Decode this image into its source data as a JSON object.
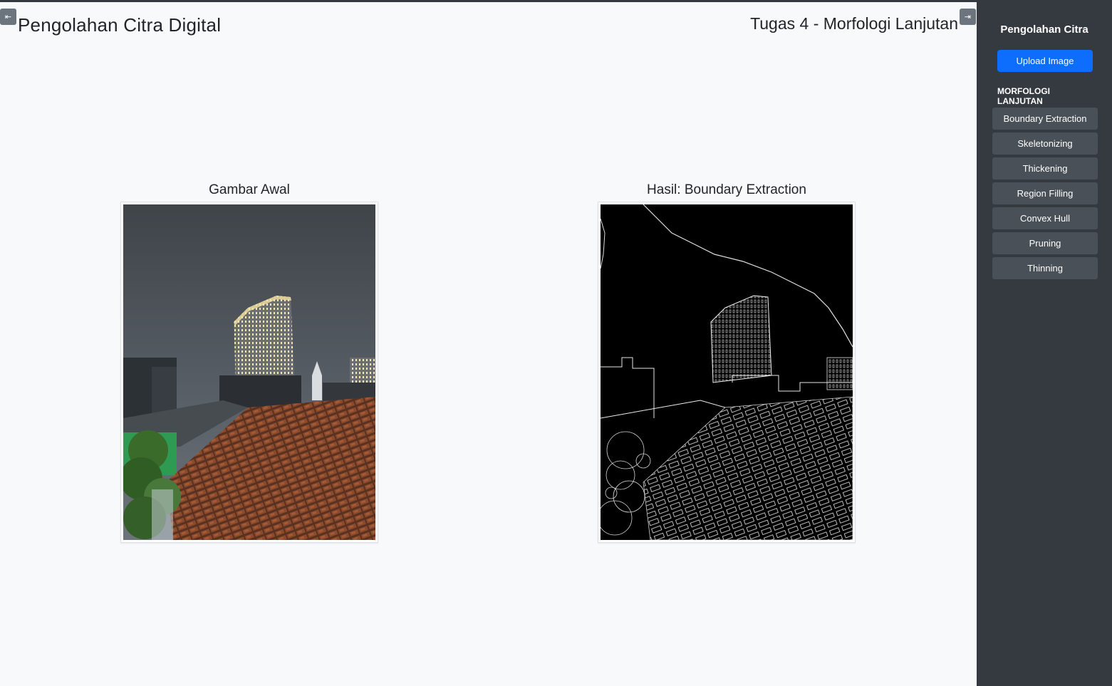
{
  "header": {
    "title": "Pengolahan Citra Digital",
    "subtitle": "Tugas 4 - Morfologi Lanjutan",
    "collapse_left_icon": "collapse-left-icon",
    "collapse_right_icon": "collapse-right-icon"
  },
  "panels": {
    "original": {
      "title": "Gambar Awal",
      "image": "night-city-rooftop-photo"
    },
    "result": {
      "title": "Hasil: Boundary Extraction",
      "image": "boundary-edge-output"
    }
  },
  "sidebar": {
    "title": "Pengolahan Citra",
    "upload_label": "Upload Image",
    "section_label": "MORFOLOGI LANJUTAN",
    "items": [
      {
        "label": "Boundary Extraction"
      },
      {
        "label": "Skeletonizing"
      },
      {
        "label": "Thickening"
      },
      {
        "label": "Region Filling"
      },
      {
        "label": "Convex Hull"
      },
      {
        "label": "Pruning"
      },
      {
        "label": "Thinning"
      }
    ]
  },
  "colors": {
    "page_bg": "#f8f9fa",
    "sidebar_bg": "#343a40",
    "menu_button": "#495057",
    "primary": "#0d6efd"
  }
}
